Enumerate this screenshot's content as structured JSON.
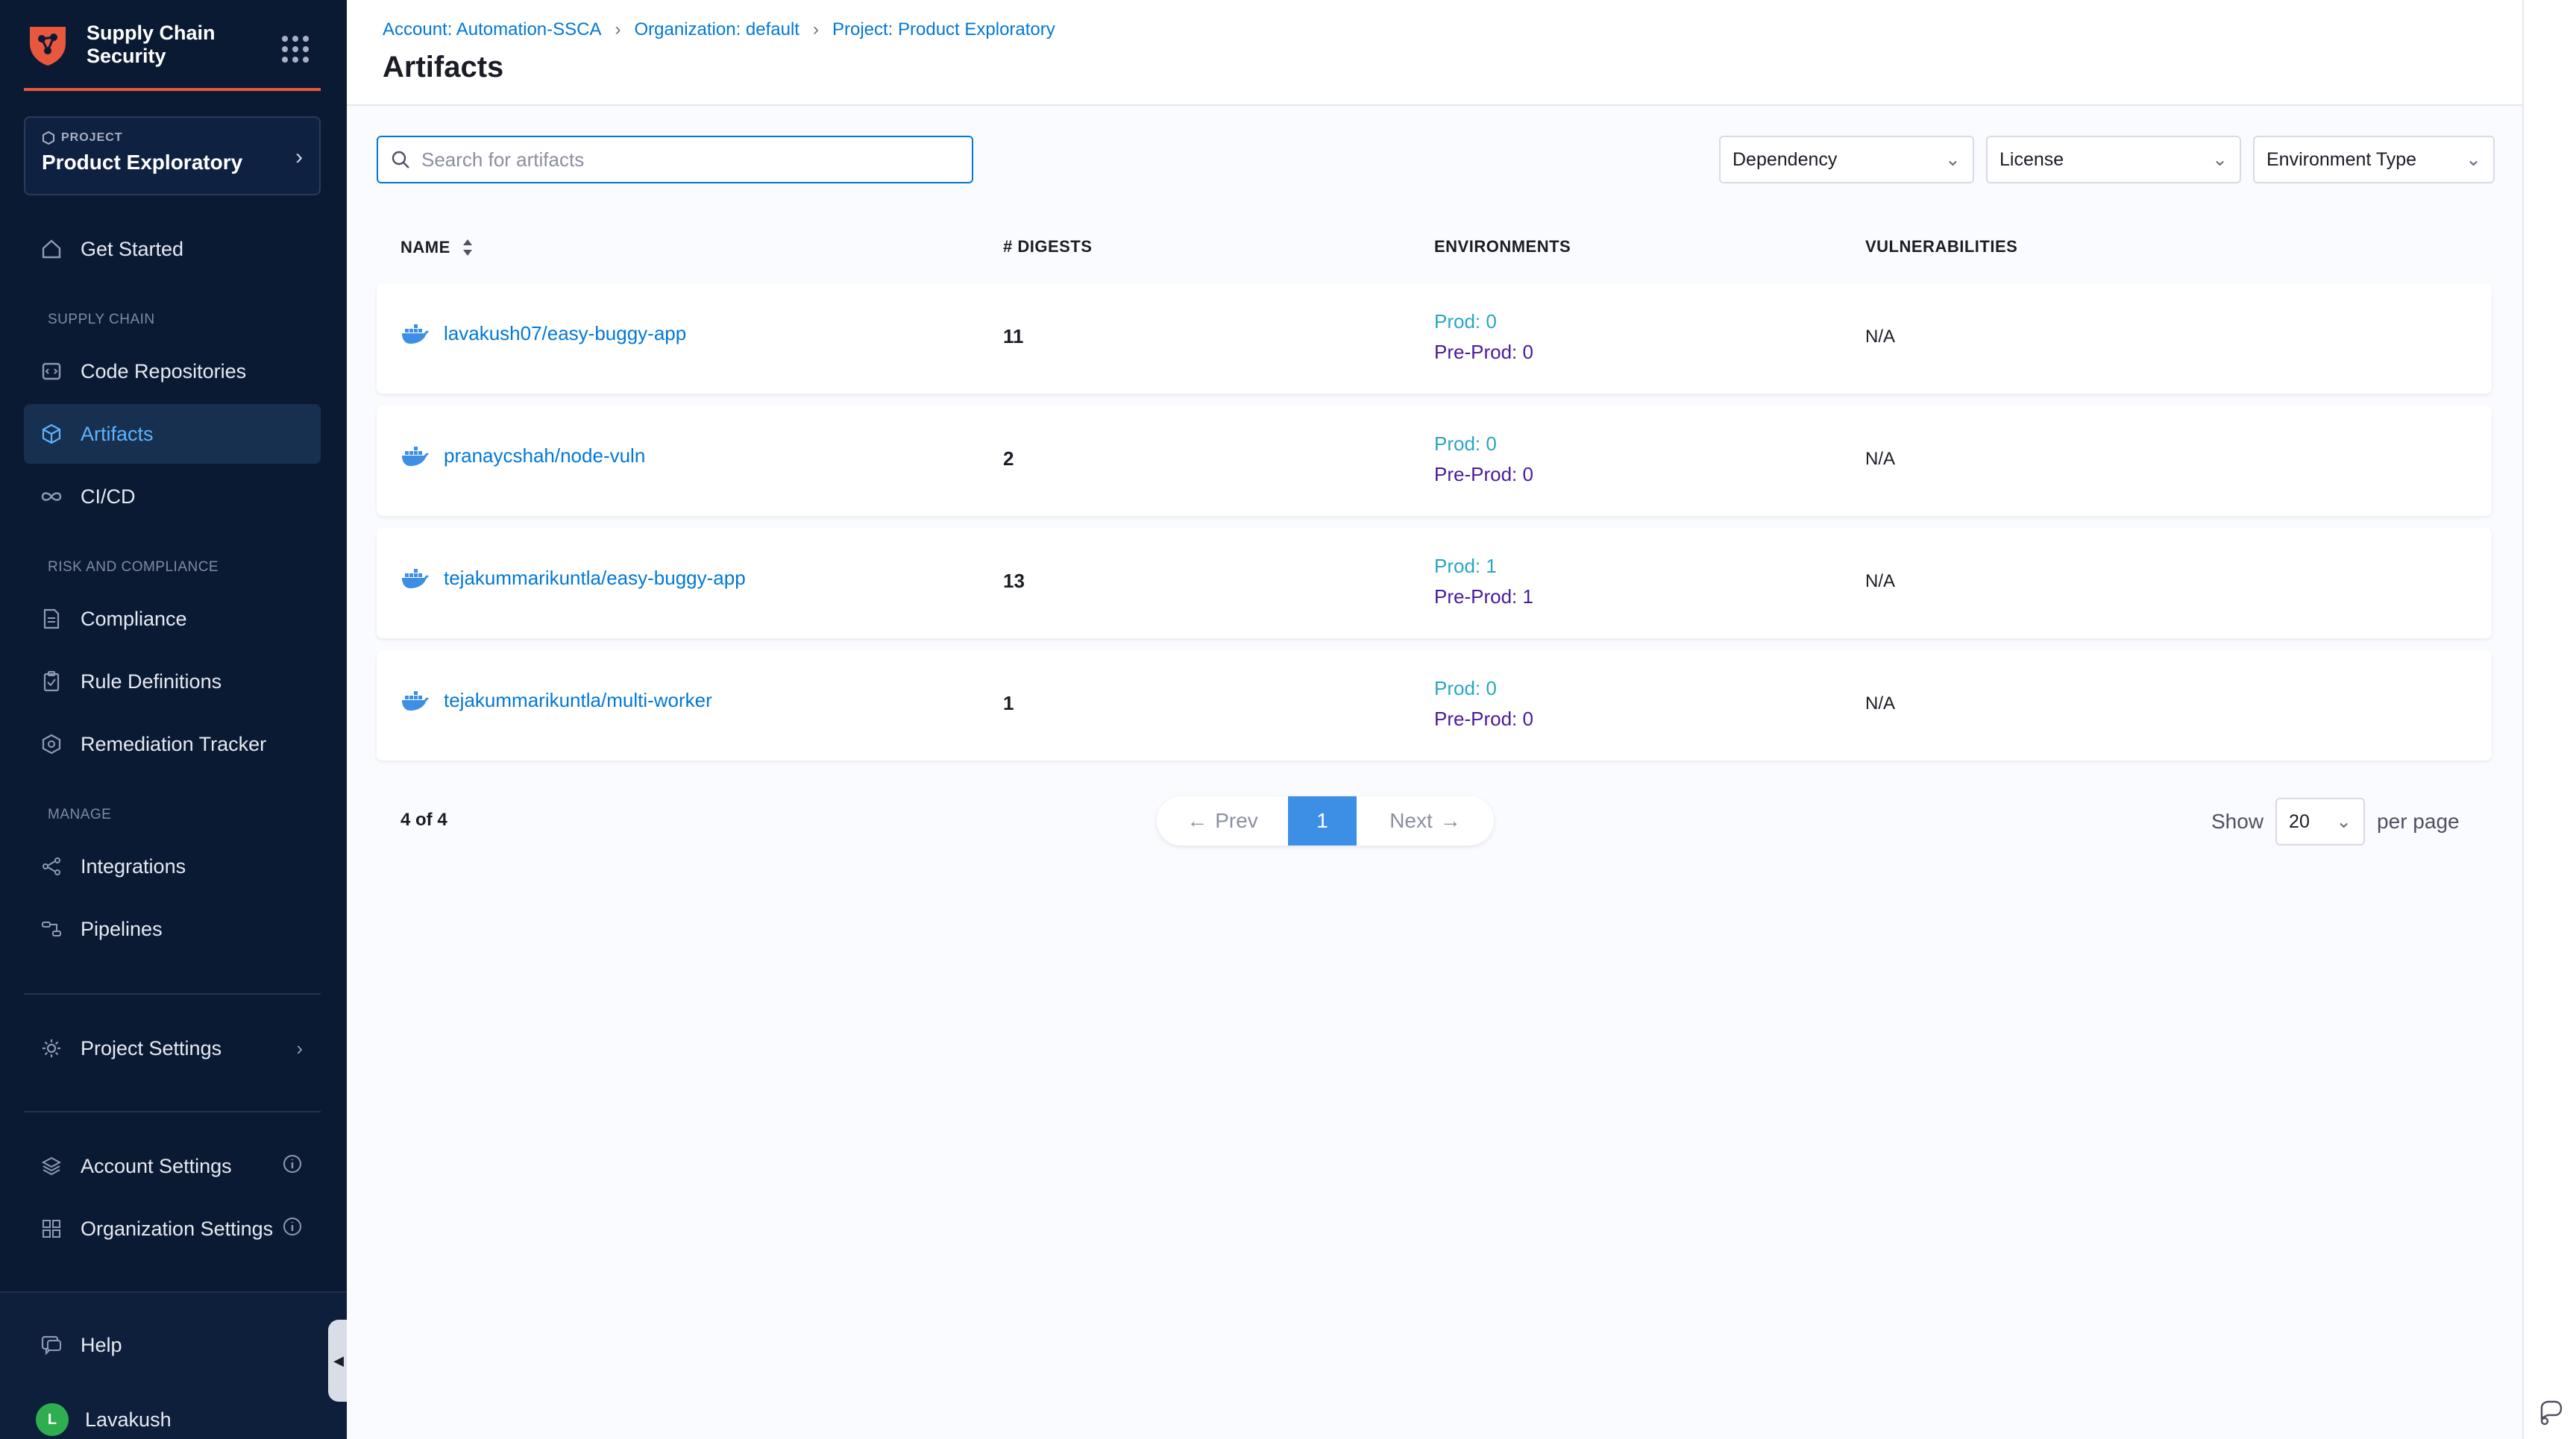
{
  "brand": {
    "title": "Supply Chain Security"
  },
  "project": {
    "kicker": "PROJECT",
    "name": "Product Exploratory"
  },
  "nav": {
    "get_started": "Get Started",
    "section_supply_chain": "SUPPLY CHAIN",
    "code_repositories": "Code Repositories",
    "artifacts": "Artifacts",
    "cicd": "CI/CD",
    "section_risk": "RISK AND COMPLIANCE",
    "compliance": "Compliance",
    "rule_definitions": "Rule Definitions",
    "remediation_tracker": "Remediation Tracker",
    "section_manage": "MANAGE",
    "integrations": "Integrations",
    "pipelines": "Pipelines",
    "project_settings": "Project Settings",
    "account_settings": "Account Settings",
    "organization_settings": "Organization Settings",
    "help": "Help",
    "user_name": "Lavakush",
    "user_initial": "L"
  },
  "breadcrumbs": [
    "Account: Automation-SSCA",
    "Organization: default",
    "Project: Product Exploratory"
  ],
  "page": {
    "title": "Artifacts"
  },
  "search": {
    "placeholder": "Search for artifacts",
    "value": ""
  },
  "filters": {
    "dependency": "Dependency",
    "license": "License",
    "environment_type": "Environment Type"
  },
  "table": {
    "headers": {
      "name": "NAME",
      "digests": "# DIGESTS",
      "environments": "ENVIRONMENTS",
      "vulnerabilities": "VULNERABILITIES"
    },
    "rows": [
      {
        "name": "lavakush07/easy-buggy-app",
        "digests": "11",
        "prod": "Prod: 0",
        "preprod": "Pre-Prod: 0",
        "vulnerabilities": "N/A"
      },
      {
        "name": "pranaycshah/node-vuln",
        "digests": "2",
        "prod": "Prod: 0",
        "preprod": "Pre-Prod: 0",
        "vulnerabilities": "N/A"
      },
      {
        "name": "tejakummarikuntla/easy-buggy-app",
        "digests": "13",
        "prod": "Prod: 1",
        "preprod": "Pre-Prod: 1",
        "vulnerabilities": "N/A"
      },
      {
        "name": "tejakummarikuntla/multi-worker",
        "digests": "1",
        "prod": "Prod: 0",
        "preprod": "Pre-Prod: 0",
        "vulnerabilities": "N/A"
      }
    ]
  },
  "pagination": {
    "count": "4 of 4",
    "prev": "Prev",
    "current_page": "1",
    "next": "Next",
    "show_label": "Show",
    "page_size": "20",
    "per_page_label": "per page"
  },
  "colors": {
    "sidebar_bg": "#0b1a33",
    "accent": "#0278d5",
    "brand_orange": "#e9573f",
    "env_prod": "#2aa5c5",
    "env_preprod": "#4a1a9c"
  }
}
